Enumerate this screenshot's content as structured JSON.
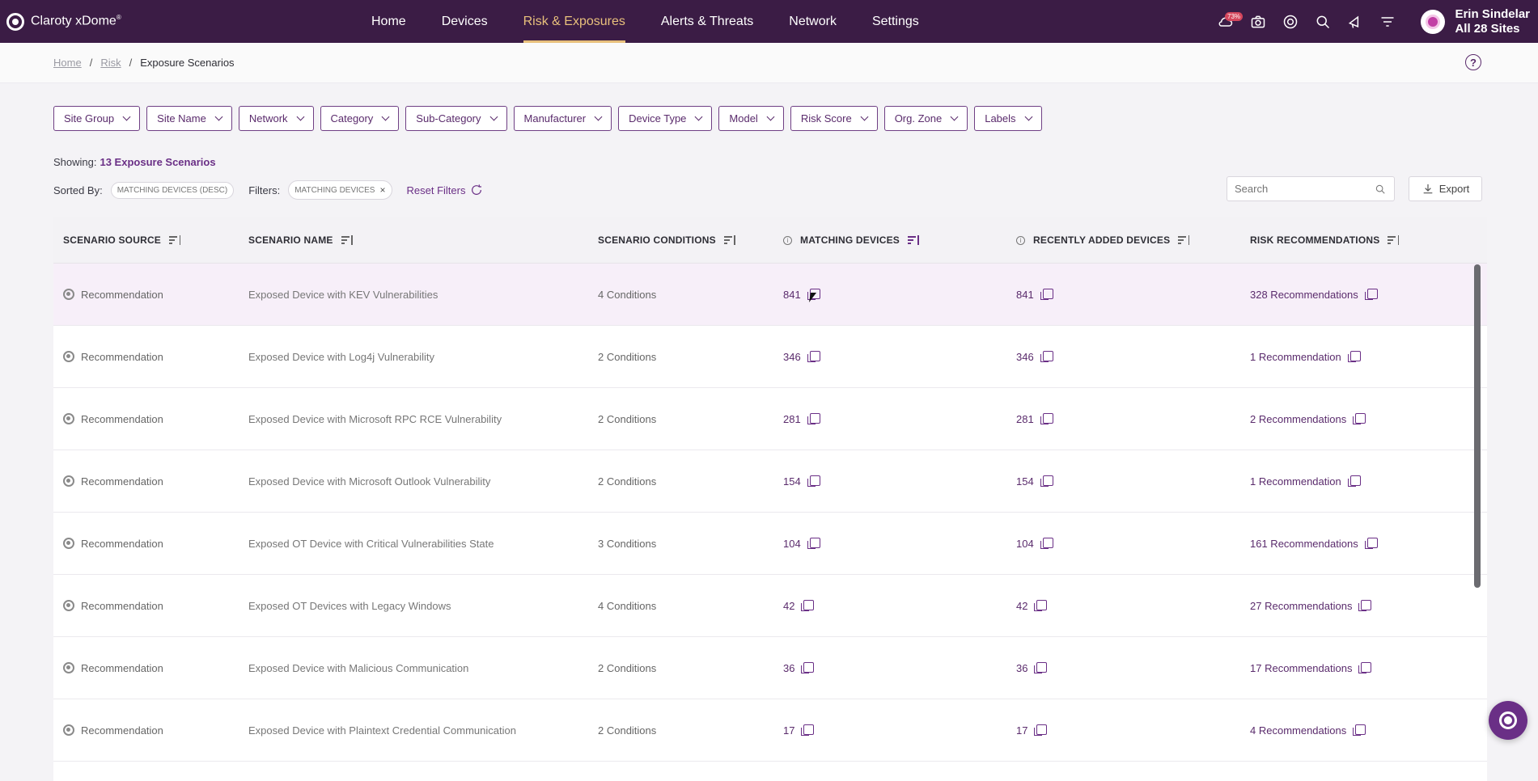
{
  "brand": {
    "name": "Claroty xDome",
    "mark": "®"
  },
  "nav": [
    {
      "label": "Home",
      "active": false
    },
    {
      "label": "Devices",
      "active": false
    },
    {
      "label": "Risk & Exposures",
      "active": true
    },
    {
      "label": "Alerts & Threats",
      "active": false
    },
    {
      "label": "Network",
      "active": false
    },
    {
      "label": "Settings",
      "active": false
    }
  ],
  "top_icons": {
    "cloud_badge": "73%"
  },
  "user": {
    "name": "Erin Sindelar",
    "sites": "All 28 Sites"
  },
  "breadcrumb": {
    "home": "Home",
    "risk": "Risk",
    "current": "Exposure Scenarios",
    "sep": "/"
  },
  "help_label": "?",
  "filters": [
    "Site Group",
    "Site Name",
    "Network",
    "Category",
    "Sub-Category",
    "Manufacturer",
    "Device Type",
    "Model",
    "Risk Score",
    "Org. Zone",
    "Labels"
  ],
  "summary": {
    "showing_label": "Showing:",
    "showing_value": "13 Exposure Scenarios"
  },
  "sorting": {
    "sorted_by_label": "Sorted By:",
    "sorted_by_chip": "MATCHING DEVICES (DESC)",
    "filters_label": "Filters:",
    "filter_chip": "MATCHING DEVICES",
    "reset_label": "Reset Filters"
  },
  "search": {
    "placeholder": "Search"
  },
  "export_label": "Export",
  "table": {
    "columns": [
      "SCENARIO SOURCE",
      "SCENARIO NAME",
      "SCENARIO CONDITIONS",
      "MATCHING DEVICES",
      "RECENTLY ADDED DEVICES",
      "RISK RECOMMENDATIONS"
    ],
    "rows": [
      {
        "source": "Recommendation",
        "name": "Exposed Device with KEV Vulnerabilities",
        "conditions": "4 Conditions",
        "matching": "841",
        "recent": "841",
        "recs": "328 Recommendations"
      },
      {
        "source": "Recommendation",
        "name": "Exposed Device with Log4j Vulnerability",
        "conditions": "2 Conditions",
        "matching": "346",
        "recent": "346",
        "recs": "1 Recommendation"
      },
      {
        "source": "Recommendation",
        "name": "Exposed Device with Microsoft RPC RCE Vulnerability",
        "conditions": "2 Conditions",
        "matching": "281",
        "recent": "281",
        "recs": "2 Recommendations"
      },
      {
        "source": "Recommendation",
        "name": "Exposed Device with Microsoft Outlook Vulnerability",
        "conditions": "2 Conditions",
        "matching": "154",
        "recent": "154",
        "recs": "1 Recommendation"
      },
      {
        "source": "Recommendation",
        "name": "Exposed OT Device with Critical Vulnerabilities State",
        "conditions": "3 Conditions",
        "matching": "104",
        "recent": "104",
        "recs": "161 Recommendations"
      },
      {
        "source": "Recommendation",
        "name": "Exposed OT Devices with Legacy Windows",
        "conditions": "4 Conditions",
        "matching": "42",
        "recent": "42",
        "recs": "27 Recommendations"
      },
      {
        "source": "Recommendation",
        "name": "Exposed Device with Malicious Communication",
        "conditions": "2 Conditions",
        "matching": "36",
        "recent": "36",
        "recs": "17 Recommendations"
      },
      {
        "source": "Recommendation",
        "name": "Exposed Device with Plaintext Credential Communication",
        "conditions": "2 Conditions",
        "matching": "17",
        "recent": "17",
        "recs": "4 Recommendations"
      }
    ]
  },
  "colors": {
    "nav_bg": "#3b1c45",
    "accent": "#6a2f86",
    "active_tab": "#e8c07c"
  }
}
